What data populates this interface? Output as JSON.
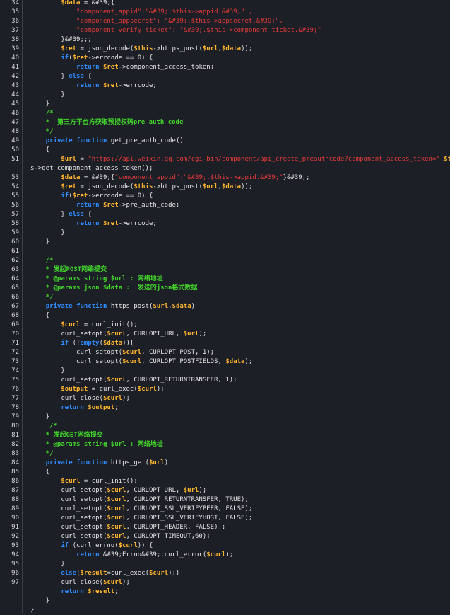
{
  "editor": {
    "colors": {
      "background": "#1c1f26",
      "keyword": "#2f8cff",
      "variable": "#ffb52e",
      "string": "#e83a3a",
      "comment": "#42d62b",
      "text": "#e6e6e6",
      "gutter_marker": "#4e9a2f"
    },
    "lines": [
      {
        "n": "34",
        "tokens": [
          [
            "        ",
            ""
          ],
          [
            "$data",
            "var"
          ],
          [
            " = &#39;{",
            ""
          ]
        ]
      },
      {
        "n": "35",
        "tokens": [
          [
            "            ",
            ""
          ],
          [
            "\"component_appid\"",
            "str"
          ],
          [
            ":\"&#39;.$this->appid.&#39;\" ,",
            "str"
          ]
        ]
      },
      {
        "n": "36",
        "tokens": [
          [
            "            ",
            ""
          ],
          [
            "\"component_appsecret\"",
            "str"
          ],
          [
            ": \"&#39;.$this->appsecret.&#39;\",",
            "str"
          ]
        ]
      },
      {
        "n": "37",
        "tokens": [
          [
            "            ",
            ""
          ],
          [
            "\"component_verify_ticket\"",
            "str"
          ],
          [
            ": \"&#39;.$this->component_ticket.&#39;\"",
            "str"
          ]
        ]
      },
      {
        "n": "38",
        "tokens": [
          [
            "        }&#39;;;",
            ""
          ]
        ]
      },
      {
        "n": "39",
        "tokens": [
          [
            "        ",
            ""
          ],
          [
            "$ret",
            "var"
          ],
          [
            " = json_decode(",
            ""
          ],
          [
            "$this",
            "var"
          ],
          [
            "->https_post(",
            ""
          ],
          [
            "$url",
            "var"
          ],
          [
            ",",
            ""
          ],
          [
            "$data",
            "var"
          ],
          [
            "));",
            ""
          ]
        ]
      },
      {
        "n": "40",
        "tokens": [
          [
            "        ",
            ""
          ],
          [
            "if",
            "kw"
          ],
          [
            "(",
            ""
          ],
          [
            "$ret",
            "var"
          ],
          [
            "->errcode == 0) {",
            ""
          ]
        ]
      },
      {
        "n": "41",
        "tokens": [
          [
            "            ",
            ""
          ],
          [
            "return",
            "kw"
          ],
          [
            " ",
            ""
          ],
          [
            "$ret",
            "var"
          ],
          [
            "->component_access_token;",
            ""
          ]
        ]
      },
      {
        "n": "42",
        "tokens": [
          [
            "        } ",
            ""
          ],
          [
            "else",
            "kw"
          ],
          [
            " {",
            ""
          ]
        ]
      },
      {
        "n": "43",
        "tokens": [
          [
            "            ",
            ""
          ],
          [
            "return",
            "kw"
          ],
          [
            " ",
            ""
          ],
          [
            "$ret",
            "var"
          ],
          [
            "->errcode;",
            ""
          ]
        ]
      },
      {
        "n": "44",
        "tokens": [
          [
            "        }",
            ""
          ]
        ]
      },
      {
        "n": "45",
        "tokens": [
          [
            "    }",
            ""
          ]
        ]
      },
      {
        "n": "46",
        "tokens": [
          [
            "    /*",
            "cmt"
          ]
        ]
      },
      {
        "n": "47",
        "tokens": [
          [
            "    *  第三方平台方获取预授权码pre_auth_code",
            "cmt"
          ]
        ]
      },
      {
        "n": "48",
        "tokens": [
          [
            "    */",
            "cmt"
          ]
        ]
      },
      {
        "n": "49",
        "tokens": [
          [
            "    ",
            ""
          ],
          [
            "private",
            "kw"
          ],
          [
            " ",
            ""
          ],
          [
            "function",
            "kw"
          ],
          [
            " get_pre_auth_code()",
            ""
          ]
        ]
      },
      {
        "n": "50",
        "tokens": [
          [
            "    {",
            ""
          ]
        ]
      },
      {
        "n": "51",
        "tokens": [
          [
            "        ",
            ""
          ],
          [
            "$url",
            "var"
          ],
          [
            " = ",
            ""
          ],
          [
            "\"https://api.weixin.qq.com/cgi-bin/component/api_create_preauthcode?component_access_token=\"",
            "str"
          ],
          [
            ".",
            ""
          ],
          [
            "$thi",
            "var"
          ]
        ]
      },
      {
        "n": "",
        "tokens": [
          [
            "s->get_component_access_token();",
            ""
          ]
        ]
      },
      {
        "n": "53",
        "tokens": [
          [
            "        ",
            ""
          ],
          [
            "$data",
            "var"
          ],
          [
            " = &#39;{",
            ""
          ],
          [
            "\"component_appid\"",
            "str"
          ],
          [
            ":\"&#39;.$this->appid.&#39;\"",
            "str"
          ],
          [
            "}&#39;;",
            ""
          ]
        ]
      },
      {
        "n": "54",
        "tokens": [
          [
            "        ",
            ""
          ],
          [
            "$ret",
            "var"
          ],
          [
            " = json_decode(",
            ""
          ],
          [
            "$this",
            "var"
          ],
          [
            "->https_post(",
            ""
          ],
          [
            "$url",
            "var"
          ],
          [
            ",",
            ""
          ],
          [
            "$data",
            "var"
          ],
          [
            "));",
            ""
          ]
        ]
      },
      {
        "n": "55",
        "tokens": [
          [
            "        ",
            ""
          ],
          [
            "if",
            "kw"
          ],
          [
            "(",
            ""
          ],
          [
            "$ret",
            "var"
          ],
          [
            "->errcode == 0) {",
            ""
          ]
        ]
      },
      {
        "n": "56",
        "tokens": [
          [
            "            ",
            ""
          ],
          [
            "return",
            "kw"
          ],
          [
            " ",
            ""
          ],
          [
            "$ret",
            "var"
          ],
          [
            "->pre_auth_code;",
            ""
          ]
        ]
      },
      {
        "n": "57",
        "tokens": [
          [
            "        } ",
            ""
          ],
          [
            "else",
            "kw"
          ],
          [
            " {",
            ""
          ]
        ]
      },
      {
        "n": "58",
        "tokens": [
          [
            "            ",
            ""
          ],
          [
            "return",
            "kw"
          ],
          [
            " ",
            ""
          ],
          [
            "$ret",
            "var"
          ],
          [
            "->errcode;",
            ""
          ]
        ]
      },
      {
        "n": "59",
        "tokens": [
          [
            "        }",
            ""
          ]
        ]
      },
      {
        "n": "60",
        "tokens": [
          [
            "    }",
            ""
          ]
        ]
      },
      {
        "n": "61",
        "tokens": []
      },
      {
        "n": "62",
        "tokens": [
          [
            "    /*",
            "cmt"
          ]
        ]
      },
      {
        "n": "63",
        "tokens": [
          [
            "    * 发起POST网络提交",
            "cmt"
          ]
        ]
      },
      {
        "n": "64",
        "tokens": [
          [
            "    * @params string $url : 网络地址",
            "cmt"
          ]
        ]
      },
      {
        "n": "65",
        "tokens": [
          [
            "    * @params json $data :  发送的json格式数据",
            "cmt"
          ]
        ]
      },
      {
        "n": "66",
        "tokens": [
          [
            "    */",
            "cmt"
          ]
        ]
      },
      {
        "n": "67",
        "tokens": [
          [
            "    ",
            ""
          ],
          [
            "private",
            "kw"
          ],
          [
            " ",
            ""
          ],
          [
            "function",
            "kw"
          ],
          [
            " https_post(",
            ""
          ],
          [
            "$url",
            "var"
          ],
          [
            ",",
            ""
          ],
          [
            "$data",
            "var"
          ],
          [
            ")",
            ""
          ]
        ]
      },
      {
        "n": "68",
        "tokens": [
          [
            "    {",
            ""
          ]
        ]
      },
      {
        "n": "69",
        "tokens": [
          [
            "        ",
            ""
          ],
          [
            "$curl",
            "var"
          ],
          [
            " = curl_init();",
            ""
          ]
        ]
      },
      {
        "n": "70",
        "tokens": [
          [
            "        curl_setopt(",
            ""
          ],
          [
            "$curl",
            "var"
          ],
          [
            ", CURLOPT_URL, ",
            ""
          ],
          [
            "$url",
            "var"
          ],
          [
            ");",
            ""
          ]
        ]
      },
      {
        "n": "71",
        "tokens": [
          [
            "        ",
            ""
          ],
          [
            "if",
            "kw"
          ],
          [
            " (!",
            ""
          ],
          [
            "empty",
            "kw"
          ],
          [
            "(",
            ""
          ],
          [
            "$data",
            "var"
          ],
          [
            ")){",
            ""
          ]
        ]
      },
      {
        "n": "72",
        "tokens": [
          [
            "            curl_setopt(",
            ""
          ],
          [
            "$curl",
            "var"
          ],
          [
            ", CURLOPT_POST, 1);",
            ""
          ]
        ]
      },
      {
        "n": "73",
        "tokens": [
          [
            "            curl_setopt(",
            ""
          ],
          [
            "$curl",
            "var"
          ],
          [
            ", CURLOPT_POSTFIELDS, ",
            ""
          ],
          [
            "$data",
            "var"
          ],
          [
            ");",
            ""
          ]
        ]
      },
      {
        "n": "74",
        "tokens": [
          [
            "        }",
            ""
          ]
        ]
      },
      {
        "n": "75",
        "tokens": [
          [
            "        curl_setopt(",
            ""
          ],
          [
            "$curl",
            "var"
          ],
          [
            ", CURLOPT_RETURNTRANSFER, 1);",
            ""
          ]
        ]
      },
      {
        "n": "76",
        "tokens": [
          [
            "        ",
            ""
          ],
          [
            "$output",
            "var"
          ],
          [
            " = curl_exec(",
            ""
          ],
          [
            "$curl",
            "var"
          ],
          [
            ");",
            ""
          ]
        ]
      },
      {
        "n": "77",
        "tokens": [
          [
            "        curl_close(",
            ""
          ],
          [
            "$curl",
            "var"
          ],
          [
            ");",
            ""
          ]
        ]
      },
      {
        "n": "78",
        "tokens": [
          [
            "        ",
            ""
          ],
          [
            "return",
            "kw"
          ],
          [
            " ",
            ""
          ],
          [
            "$output",
            "var"
          ],
          [
            ";",
            ""
          ]
        ]
      },
      {
        "n": "79",
        "tokens": [
          [
            "    }",
            ""
          ]
        ]
      },
      {
        "n": "80",
        "tokens": [
          [
            "     /*",
            "cmt"
          ]
        ]
      },
      {
        "n": "81",
        "tokens": [
          [
            "    * 发起GET网络提交",
            "cmt"
          ]
        ]
      },
      {
        "n": "82",
        "tokens": [
          [
            "    * @params string $url : 网络地址",
            "cmt"
          ]
        ]
      },
      {
        "n": "83",
        "tokens": [
          [
            "    */",
            "cmt"
          ]
        ]
      },
      {
        "n": "84",
        "tokens": [
          [
            "    ",
            ""
          ],
          [
            "private",
            "kw"
          ],
          [
            " ",
            ""
          ],
          [
            "function",
            "kw"
          ],
          [
            " https_get(",
            ""
          ],
          [
            "$url",
            "var"
          ],
          [
            ")",
            ""
          ]
        ]
      },
      {
        "n": "85",
        "tokens": [
          [
            "    {",
            ""
          ]
        ]
      },
      {
        "n": "86",
        "tokens": [
          [
            "        ",
            ""
          ],
          [
            "$curl",
            "var"
          ],
          [
            " = curl_init();",
            ""
          ]
        ]
      },
      {
        "n": "87",
        "tokens": [
          [
            "        curl_setopt(",
            ""
          ],
          [
            "$curl",
            "var"
          ],
          [
            ", CURLOPT_URL, ",
            ""
          ],
          [
            "$url",
            "var"
          ],
          [
            ");",
            ""
          ]
        ]
      },
      {
        "n": "88",
        "tokens": [
          [
            "        curl_setopt(",
            ""
          ],
          [
            "$curl",
            "var"
          ],
          [
            ", CURLOPT_RETURNTRANSFER, TRUE);",
            ""
          ]
        ]
      },
      {
        "n": "89",
        "tokens": [
          [
            "        curl_setopt(",
            ""
          ],
          [
            "$curl",
            "var"
          ],
          [
            ", CURLOPT_SSL_VERIFYPEER, FALSE);",
            ""
          ]
        ]
      },
      {
        "n": "90",
        "tokens": [
          [
            "        curl_setopt(",
            ""
          ],
          [
            "$curl",
            "var"
          ],
          [
            ", CURLOPT_SSL_VERIFYHOST, FALSE);",
            ""
          ]
        ]
      },
      {
        "n": "91",
        "tokens": [
          [
            "        curl_setopt(",
            ""
          ],
          [
            "$curl",
            "var"
          ],
          [
            ", CURLOPT_HEADER, FALSE) ;",
            ""
          ]
        ]
      },
      {
        "n": "92",
        "tokens": [
          [
            "        curl_setopt(",
            ""
          ],
          [
            "$curl",
            "var"
          ],
          [
            ", CURLOPT_TIMEOUT,60);",
            ""
          ]
        ]
      },
      {
        "n": "93",
        "tokens": [
          [
            "        ",
            ""
          ],
          [
            "if",
            "kw"
          ],
          [
            " (curl_errno(",
            ""
          ],
          [
            "$curl",
            "var"
          ],
          [
            ")) {",
            ""
          ]
        ]
      },
      {
        "n": "94",
        "tokens": [
          [
            "            ",
            ""
          ],
          [
            "return",
            "kw"
          ],
          [
            " &#39;Errno&#39;.curl_error(",
            ""
          ],
          [
            "$curl",
            "var"
          ],
          [
            ");",
            ""
          ]
        ]
      },
      {
        "n": "95",
        "tokens": [
          [
            "        }",
            ""
          ]
        ]
      },
      {
        "n": "96",
        "tokens": [
          [
            "        ",
            ""
          ],
          [
            "else",
            "kw"
          ],
          [
            "{",
            ""
          ],
          [
            "$result",
            "var"
          ],
          [
            "=curl_exec(",
            ""
          ],
          [
            "$curl",
            "var"
          ],
          [
            ");}",
            ""
          ]
        ]
      },
      {
        "n": "97",
        "tokens": [
          [
            "        curl_close(",
            ""
          ],
          [
            "$curl",
            "var"
          ],
          [
            ");",
            ""
          ]
        ]
      },
      {
        "n": "",
        "tokens": [
          [
            "        ",
            ""
          ],
          [
            "return",
            "kw"
          ],
          [
            " ",
            ""
          ],
          [
            "$result",
            "var"
          ],
          [
            ";",
            ""
          ]
        ]
      },
      {
        "n": "",
        "tokens": [
          [
            "    }",
            ""
          ]
        ]
      }
    ],
    "final_brace": "}"
  }
}
